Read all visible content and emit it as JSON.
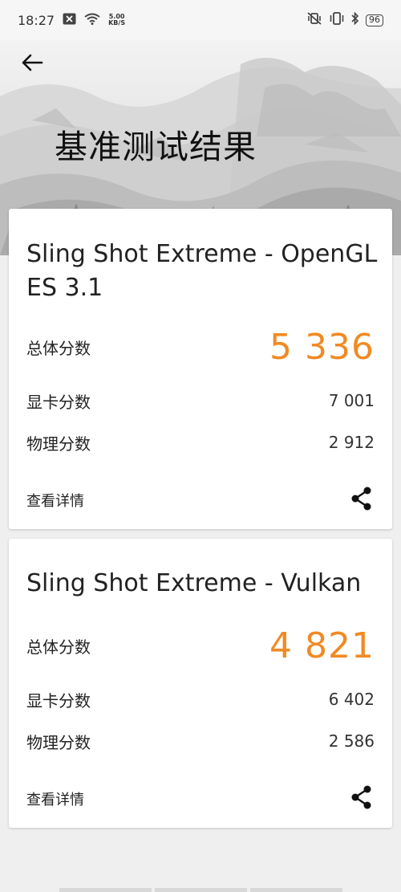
{
  "status_bar": {
    "time": "18:27",
    "net_speed_value": "5.00",
    "net_speed_unit": "KB/S",
    "battery": "96"
  },
  "header": {
    "title": "基准测试结果"
  },
  "results": [
    {
      "title": "Sling Shot Extreme - OpenGL ES 3.1",
      "total_label": "总体分数",
      "total_value": "5 336",
      "graphics_label": "显卡分数",
      "graphics_value": "7 001",
      "physics_label": "物理分数",
      "physics_value": "2 912",
      "details_label": "查看详情"
    },
    {
      "title": "Sling Shot Extreme - Vulkan",
      "total_label": "总体分数",
      "total_value": "4 821",
      "graphics_label": "显卡分数",
      "graphics_value": "6 402",
      "physics_label": "物理分数",
      "physics_value": "2 586",
      "details_label": "查看详情"
    }
  ],
  "colors": {
    "accent": "#f08a24",
    "background": "#efefef",
    "card": "#ffffff"
  },
  "icons": {
    "back": "arrow-left-icon",
    "share": "share-icon",
    "wifi": "wifi-icon",
    "mute": "vibrate-mute-icon",
    "bluetooth": "bluetooth-icon",
    "notification": "notification-icon"
  }
}
